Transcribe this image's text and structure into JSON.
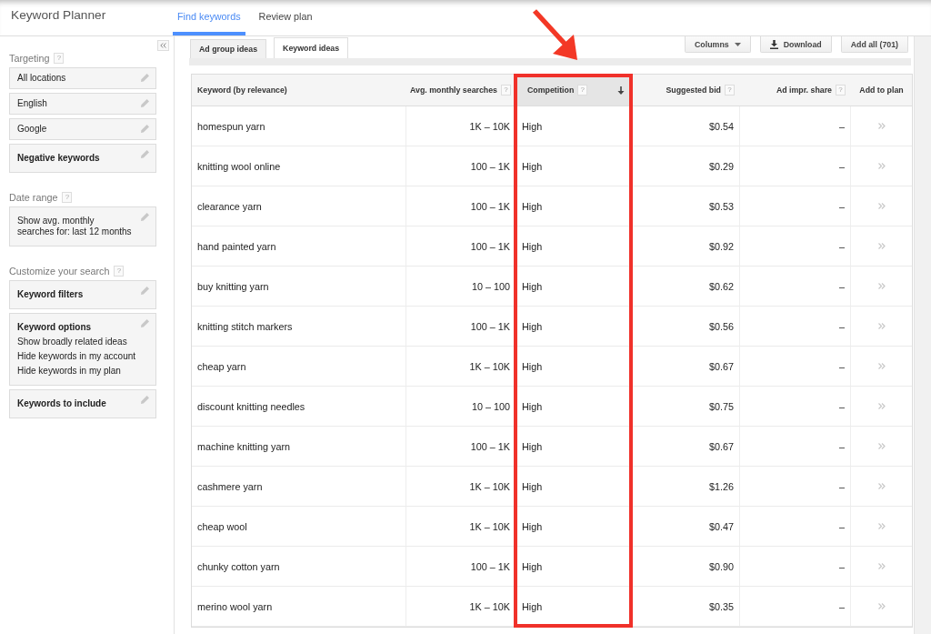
{
  "header": {
    "app_title": "Keyword Planner",
    "nav_tabs": [
      {
        "label": "Find keywords",
        "selected": true
      },
      {
        "label": "Review plan",
        "selected": false
      }
    ]
  },
  "sidebar": {
    "sections": [
      {
        "title": "Targeting",
        "help": "?",
        "cards": [
          {
            "kind": "value",
            "label": "All locations"
          },
          {
            "kind": "value",
            "label": "English"
          },
          {
            "kind": "value",
            "label": "Google"
          },
          {
            "kind": "heading",
            "label": "Negative keywords"
          }
        ]
      },
      {
        "title": "Date range",
        "help": "?",
        "cards": [
          {
            "kind": "summary",
            "label": "Show avg. monthly searches for: last 12 months"
          }
        ]
      },
      {
        "title": "Customize your search",
        "help": "?",
        "cards": [
          {
            "kind": "heading",
            "label": "Keyword filters"
          },
          {
            "kind": "heading",
            "label": "Keyword options",
            "lines": [
              "Show broadly related ideas",
              "Hide keywords in my account",
              "Hide keywords in my plan"
            ]
          },
          {
            "kind": "heading",
            "label": "Keywords to include"
          }
        ]
      }
    ]
  },
  "results": {
    "tabs": [
      {
        "label": "Ad group ideas",
        "selected": false
      },
      {
        "label": "Keyword ideas",
        "selected": true
      }
    ],
    "toolbar": [
      {
        "kind": "dropdown",
        "label": "Columns"
      },
      {
        "kind": "download",
        "label": "Download"
      },
      {
        "kind": "plain",
        "label": "Add all (701)"
      }
    ]
  },
  "table": {
    "columns": [
      {
        "label": "Keyword (by relevance)",
        "kind": "text",
        "sorted": false,
        "highlighted": false
      },
      {
        "label": "Avg. monthly searches",
        "help": "?",
        "kind": "number",
        "sorted": false,
        "highlighted": false
      },
      {
        "label": "Competition",
        "help": "?",
        "kind": "text",
        "sorted": true,
        "highlighted": true
      },
      {
        "label": "Suggested bid",
        "help": "?",
        "kind": "number",
        "sorted": false,
        "highlighted": false
      },
      {
        "label": "Ad impr. share",
        "help": "?",
        "kind": "number",
        "sorted": false,
        "highlighted": false
      },
      {
        "label": "Add to plan",
        "kind": "action",
        "sorted": false,
        "highlighted": false
      }
    ],
    "rows": [
      {
        "cells": [
          "homespun yarn",
          "1K – 10K",
          "High",
          "$0.54",
          "–"
        ]
      },
      {
        "cells": [
          "knitting wool online",
          "100 – 1K",
          "High",
          "$0.29",
          "–"
        ]
      },
      {
        "cells": [
          "clearance yarn",
          "100 – 1K",
          "High",
          "$0.53",
          "–"
        ]
      },
      {
        "cells": [
          "hand painted yarn",
          "100 – 1K",
          "High",
          "$0.92",
          "–"
        ]
      },
      {
        "cells": [
          "buy knitting yarn",
          "10 – 100",
          "High",
          "$0.62",
          "–"
        ]
      },
      {
        "cells": [
          "knitting stitch markers",
          "100 – 1K",
          "High",
          "$0.56",
          "–"
        ]
      },
      {
        "cells": [
          "cheap yarn",
          "1K – 10K",
          "High",
          "$0.67",
          "–"
        ]
      },
      {
        "cells": [
          "discount knitting needles",
          "10 – 100",
          "High",
          "$0.75",
          "–"
        ]
      },
      {
        "cells": [
          "machine knitting yarn",
          "100 – 1K",
          "High",
          "$0.67",
          "–"
        ]
      },
      {
        "cells": [
          "cashmere yarn",
          "1K – 10K",
          "High",
          "$1.26",
          "–"
        ]
      },
      {
        "cells": [
          "cheap wool",
          "1K – 10K",
          "High",
          "$0.47",
          "–"
        ]
      },
      {
        "cells": [
          "chunky cotton yarn",
          "100 – 1K",
          "High",
          "$0.90",
          "–"
        ]
      },
      {
        "cells": [
          "merino wool yarn",
          "1K – 10K",
          "High",
          "$0.35",
          "–"
        ]
      }
    ]
  }
}
